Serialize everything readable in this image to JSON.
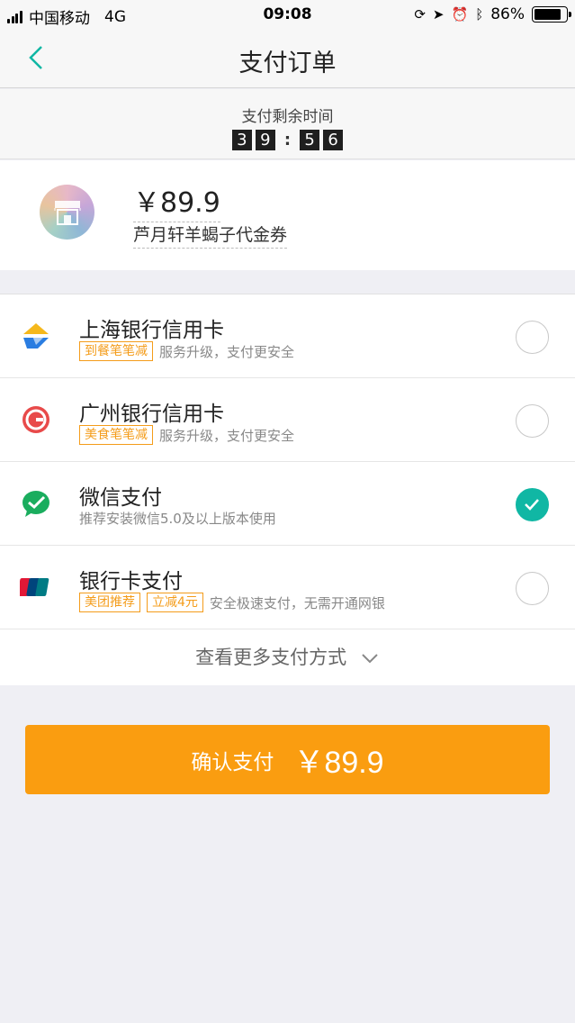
{
  "status_bar": {
    "carrier": "中国移动",
    "network": "4G",
    "time": "09:08",
    "battery": "86%",
    "battery_level": 0.86
  },
  "nav": {
    "title": "支付订单"
  },
  "timer": {
    "label": "支付剩余时间",
    "digits": [
      "3",
      "9",
      "5",
      "6"
    ]
  },
  "order": {
    "price": "￥89.9",
    "name": "芦月轩羊蝎子代金券"
  },
  "payments": [
    {
      "name": "上海银行信用卡",
      "tags": [
        "到餐笔笔减"
      ],
      "desc": "服务升级，支付更安全",
      "selected": false,
      "icon": "shanghai-bank-icon"
    },
    {
      "name": "广州银行信用卡",
      "tags": [
        "美食笔笔减"
      ],
      "desc": "服务升级，支付更安全",
      "selected": false,
      "icon": "guangzhou-bank-icon"
    },
    {
      "name": "微信支付",
      "tags": [],
      "desc": "推荐安装微信5.0及以上版本使用",
      "selected": true,
      "icon": "wechat-pay-icon"
    },
    {
      "name": "银行卡支付",
      "tags": [
        "美团推荐",
        "立减4元"
      ],
      "desc": "安全极速支付，无需开通网银",
      "selected": false,
      "icon": "unionpay-icon"
    }
  ],
  "more_methods": "查看更多支付方式",
  "confirm": {
    "label": "确认支付",
    "price": "￥89.9"
  },
  "colors": {
    "accent": "#10b7a4",
    "button": "#fa9d10",
    "tag": "#f49c1a"
  }
}
